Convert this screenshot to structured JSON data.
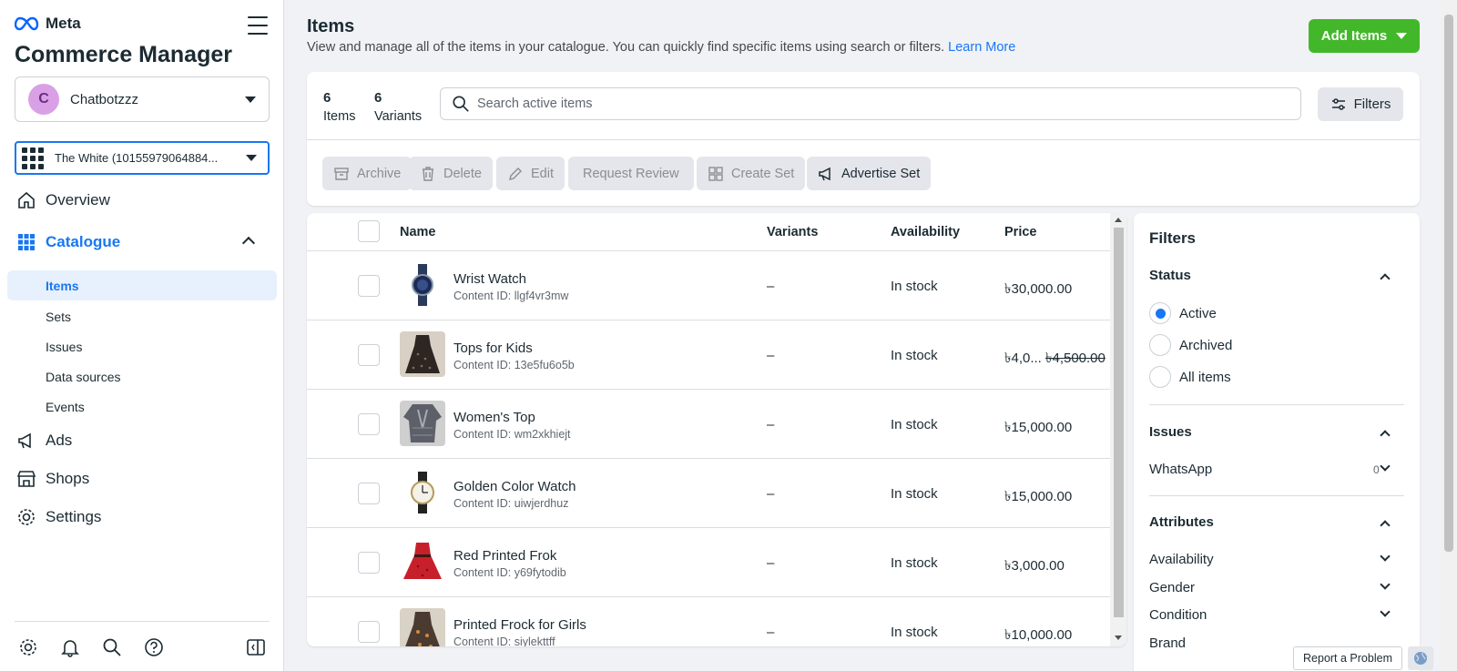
{
  "brand": {
    "logo_text": "Meta",
    "app_title": "Commerce Manager"
  },
  "account": {
    "initial": "C",
    "name": "Chatbotzzz"
  },
  "catalog": {
    "name": "The White (10155979064884..."
  },
  "nav": {
    "overview": "Overview",
    "catalogue": "Catalogue",
    "sub_items": [
      "Items",
      "Sets",
      "Issues",
      "Data sources",
      "Events"
    ],
    "ads": "Ads",
    "shops": "Shops",
    "settings": "Settings"
  },
  "header": {
    "title": "Items",
    "subtitle": "View and manage all of the items in your catalogue. You can quickly find specific items using search or filters.",
    "learn_more": "Learn More",
    "add_items": "Add Items"
  },
  "stats": {
    "items_count": "6",
    "items_label": "Items",
    "variants_count": "6",
    "variants_label": "Variants"
  },
  "search": {
    "placeholder": "Search active items"
  },
  "filters_button": "Filters",
  "actions": {
    "archive": "Archive",
    "delete": "Delete",
    "edit": "Edit",
    "request_review": "Request Review",
    "create_set": "Create Set",
    "advertise_set": "Advertise Set"
  },
  "table": {
    "columns": {
      "name": "Name",
      "variants": "Variants",
      "availability": "Availability",
      "price": "Price"
    },
    "rows": [
      {
        "name": "Wrist Watch",
        "content_id": "Content ID: llgf4vr3mw",
        "variants": "–",
        "availability": "In stock",
        "price": "৳30,000.00",
        "old_price": ""
      },
      {
        "name": "Tops for Kids",
        "content_id": "Content ID: 13e5fu6o5b",
        "variants": "–",
        "availability": "In stock",
        "price": "৳4,0...",
        "old_price": "৳4,500.00"
      },
      {
        "name": "Women's Top",
        "content_id": "Content ID: wm2xkhiejt",
        "variants": "–",
        "availability": "In stock",
        "price": "৳15,000.00",
        "old_price": ""
      },
      {
        "name": "Golden Color Watch",
        "content_id": "Content ID: uiwjerdhuz",
        "variants": "–",
        "availability": "In stock",
        "price": "৳15,000.00",
        "old_price": ""
      },
      {
        "name": "Red Printed Frok",
        "content_id": "Content ID: y69fytodib",
        "variants": "–",
        "availability": "In stock",
        "price": "৳3,000.00",
        "old_price": ""
      },
      {
        "name": "Printed Frock for Girls",
        "content_id": "Content ID: siylekttff",
        "variants": "–",
        "availability": "In stock",
        "price": "৳10,000.00",
        "old_price": ""
      }
    ]
  },
  "filter_panel": {
    "title": "Filters",
    "status_heading": "Status",
    "status_options": [
      "Active",
      "Archived",
      "All items"
    ],
    "issues_heading": "Issues",
    "issues": [
      {
        "label": "WhatsApp",
        "count": "0"
      }
    ],
    "attributes_heading": "Attributes",
    "attributes": [
      "Availability",
      "Gender",
      "Condition",
      "Brand"
    ]
  },
  "footer": {
    "report_problem": "Report a Problem"
  },
  "colors": {
    "accent": "#1877f2",
    "primary_button": "#42b72a"
  }
}
